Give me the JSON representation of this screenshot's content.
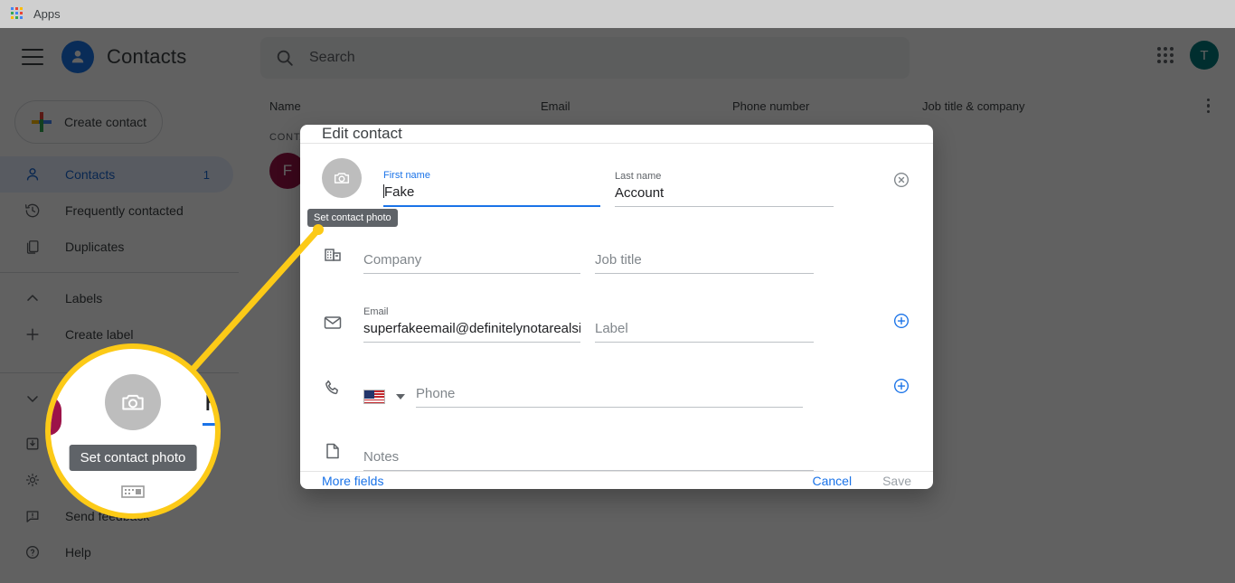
{
  "browser": {
    "bookmark_label": "Apps",
    "apps_icon": "google-apps-grid-icon"
  },
  "header": {
    "menu_icon": "hamburger-menu-icon",
    "brand_icon": "contacts-person-icon",
    "title": "Contacts",
    "search": {
      "icon": "search-icon",
      "placeholder": "Search",
      "value": ""
    },
    "apps_launcher_icon": "google-apps-waffle-icon",
    "avatar_initial": "T",
    "avatar_color": "#00797b"
  },
  "sidebar": {
    "create_button": "Create contact",
    "items": [
      {
        "label": "Contacts",
        "icon": "person-icon",
        "badge": "1",
        "active": true
      },
      {
        "label": "Frequently contacted",
        "icon": "history-clock-icon",
        "badge": "",
        "active": false
      },
      {
        "label": "Duplicates",
        "icon": "duplicates-copy-icon",
        "badge": "",
        "active": false
      },
      {
        "label": "Labels",
        "icon": "chevron-up-icon",
        "badge": "",
        "active": false
      },
      {
        "label": "Create label",
        "icon": "plus-icon",
        "badge": "",
        "active": false
      },
      {
        "label": "",
        "icon": "chevron-down-icon",
        "badge": "",
        "active": false
      },
      {
        "label": "Import",
        "icon": "import-export-icon",
        "badge": "",
        "active": false
      },
      {
        "label": "",
        "icon": "settings-gear-icon",
        "badge": "",
        "active": false
      },
      {
        "label": "Send feedback",
        "icon": "feedback-chat-icon",
        "badge": "",
        "active": false
      },
      {
        "label": "Help",
        "icon": "help-question-icon",
        "badge": "",
        "active": false
      }
    ]
  },
  "table": {
    "columns": [
      "Name",
      "Email",
      "Phone number",
      "Job title & company"
    ],
    "more_icon": "kebab-menu-icon",
    "section_label": "CONTACTS",
    "rows": [
      {
        "avatar_initial": "F",
        "avatar_color": "#9c1349"
      }
    ]
  },
  "dialog": {
    "title": "Edit contact",
    "photo": {
      "icon": "camera-icon",
      "tooltip": "Set contact photo"
    },
    "fields": {
      "first_name": {
        "label": "First name",
        "value": "Fake",
        "focused": true
      },
      "last_name": {
        "label": "Last name",
        "value": "Account",
        "focused": false
      },
      "company": {
        "label": "",
        "placeholder": "Company",
        "value": "",
        "icon": "company-building-icon"
      },
      "job_title": {
        "label": "",
        "placeholder": "Job title",
        "value": ""
      },
      "email": {
        "label": "Email",
        "value": "superfakeemail@definitelynotarealsite",
        "icon": "envelope-icon"
      },
      "email_label": {
        "placeholder": "Label",
        "value": ""
      },
      "phone": {
        "placeholder": "Phone",
        "value": "",
        "icon": "phone-icon",
        "country": "US"
      },
      "notes": {
        "placeholder": "Notes",
        "value": "",
        "icon": "note-page-icon"
      }
    },
    "clear_icon": "clear-circle-x-icon",
    "add_email_icon": "add-circle-plus-icon",
    "add_phone_icon": "add-circle-plus-icon",
    "footer": {
      "more_fields": "More fields",
      "cancel": "Cancel",
      "save": "Save"
    }
  },
  "callout": {
    "tooltip": "Set contact photo",
    "avatar_icon": "camera-icon",
    "accent_color": "#fcca17",
    "first_letter": "F"
  },
  "colors": {
    "brand_blue": "#1a73e8",
    "highlight_yellow": "#fcca17",
    "avatar_teal": "#00797b",
    "contact_maroon": "#9c1349",
    "overlay": "rgba(0,0,0,0.62)"
  }
}
